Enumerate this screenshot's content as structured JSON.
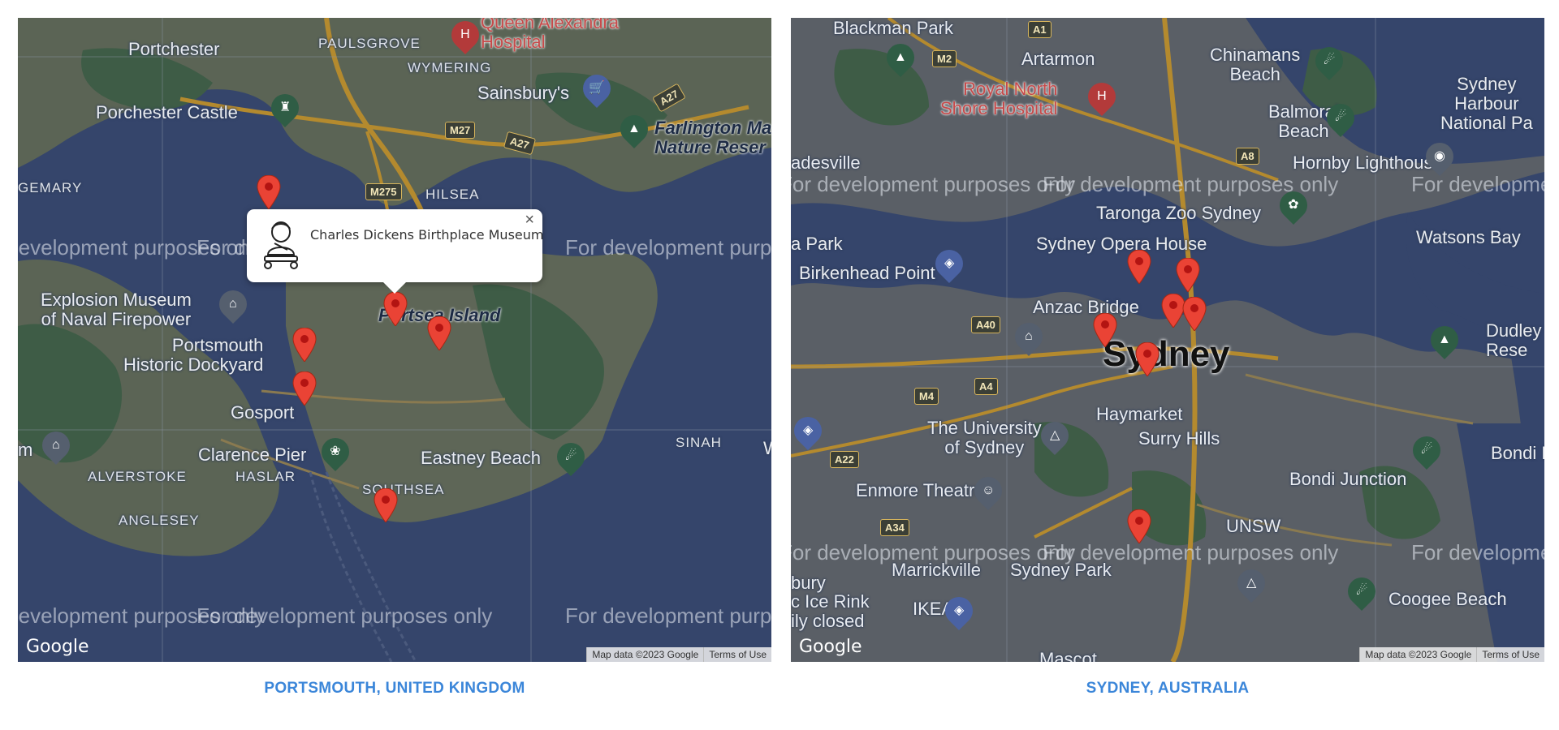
{
  "maps": [
    {
      "caption": "PORTSMOUTH, UNITED KINGDOM",
      "infowindow": {
        "title": "Charles Dickens Birthplace Museum",
        "close": "×"
      },
      "google_logo": "Google",
      "attribution": [
        "Map data ©2023 Google",
        "Terms of Use"
      ],
      "watermark": "For development purposes only",
      "labels": {
        "portchester": "Portchester",
        "paulsgrove": "PAULSGROVE",
        "queen_alexandra": "Queen Alexandra\nHospital",
        "wymering": "WYMERING",
        "sainsburys": "Sainsbury's",
        "portchester_castle": "Porchester Castle",
        "farlington": "Farlington Ma\nNature Reser",
        "hilsea": "HILSEA",
        "gemary": "GEMARY",
        "explosion": "Explosion Museum\nof Naval Firepower",
        "portsea_island": "Portsea Island",
        "portsmouth_hd": "Portsmouth\nHistoric Dockyard",
        "gosport": "Gosport",
        "clarence_pier": "Clarence Pier",
        "eastney_beach": "Eastney Beach",
        "sinah": "SINAH",
        "alverstoke": "ALVERSTOKE",
        "haslar": "HASLAR",
        "southsea": "SOUTHSEA",
        "anglesey": "ANGLESEY",
        "m": "m",
        "w": "W"
      },
      "shields": [
        "M275",
        "M27",
        "A27",
        "A27"
      ]
    },
    {
      "caption": "SYDNEY, AUSTRALIA",
      "google_logo": "Google",
      "attribution": [
        "Map data ©2023 Google",
        "Terms of Use"
      ],
      "watermark": "For development purposes only",
      "labels": {
        "blackman_park": "Blackman Park",
        "artarmon": "Artarmon",
        "chinamans": "Chinamans\nBeach",
        "sydney_harbour": "Sydney\nHarbour\nNational Pa",
        "royal_north": "Royal North\nShore Hospital",
        "balmoral": "Balmoral\nBeach",
        "hornby": "Hornby Lighthouse",
        "gladesville": "adesville",
        "taronga": "Taronga Zoo Sydney",
        "watsons_bay": "Watsons Bay",
        "opera_house": "Sydney Opera House",
        "a_park": "a Park",
        "birkenhead": "Birkenhead Point",
        "anzac_bridge": "Anzac Bridge",
        "dudley": "Dudley\nRese",
        "sydney": "Sydney",
        "haymarket": "Haymarket",
        "surry_hills": "Surry Hills",
        "university": "The University\nof Sydney",
        "bondi_beach": "Bondi Be",
        "bondi_junction": "Bondi Junction",
        "enmore": "Enmore Theatre",
        "unsw": "UNSW",
        "marrickville": "Marrickville",
        "sydney_park": "Sydney Park",
        "coogee": "Coogee Beach",
        "bury": "bury",
        "ice_rink": "c Ice Rink\nily closed",
        "ikea": "IKEA",
        "mascot": "Mascot"
      },
      "shields": [
        "A1",
        "M2",
        "A8",
        "A40",
        "A4",
        "M4",
        "A22",
        "A34"
      ]
    }
  ]
}
